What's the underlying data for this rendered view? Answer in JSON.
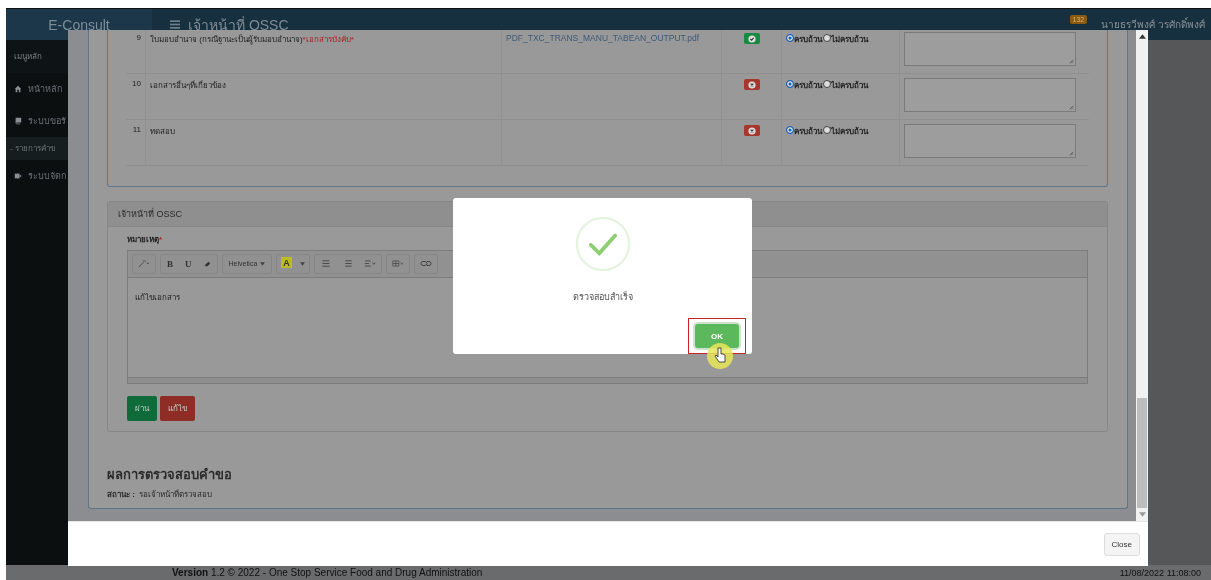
{
  "header": {
    "brand": "E-Consult",
    "title": "เจ้าหน้าที่ OSSC",
    "badge": "132",
    "user": "นายธรวีพงศ์ วรศักดิ์พงศ์"
  },
  "sidebar": {
    "heading": "เมนูหลัก",
    "items": [
      {
        "label": "หน้าหลัก",
        "kind": "home",
        "selected": false
      },
      {
        "label": "ระบบขอรั",
        "kind": "book",
        "selected": false
      },
      {
        "label": "- รายการคำข",
        "kind": "sub",
        "selected": true
      },
      {
        "label": "ระบบจัดก",
        "kind": "video",
        "selected": false
      }
    ]
  },
  "modal": {
    "documents": [
      {
        "no": "9",
        "name": "ใบมอบอำนาจ (กรณีฐานะเป็นผู้รับมอบอำนาจ)",
        "required_note": "*เอกสารบังคับ*",
        "file": "PDF_TXC_TRANS_MANU_TABEAN_OUTPUT.pdf",
        "uploaded": true,
        "options": [
          {
            "label": "ครบถ้วน",
            "selected": true
          },
          {
            "label": "ไม่ครบถ้วน",
            "selected": false
          }
        ]
      },
      {
        "no": "10",
        "name": "เอกสารอื่นๆที่เกี่ยวข้อง",
        "uploaded": false,
        "options": [
          {
            "label": "ครบถ้วน",
            "selected": true
          },
          {
            "label": "ไม่ครบถ้วน",
            "selected": false
          }
        ]
      },
      {
        "no": "11",
        "name": "ทดสอบ",
        "uploaded": false,
        "options": [
          {
            "label": "ครบถ้วน",
            "selected": true
          },
          {
            "label": "ไม่ครบถ้วน",
            "selected": false
          }
        ]
      }
    ],
    "officer_panel": {
      "title": "เจ้าหน้าที่ OSSC",
      "remark_label": "หมายเหตุ",
      "required_mark": "*",
      "toolbar": {
        "bold": "B",
        "underline": "U",
        "font": "Helvetica",
        "font_color_button": "A"
      },
      "editor_text": "แก้ไขเอกสาร",
      "buttons": [
        {
          "label": "ผ่าน",
          "kind": "approve"
        },
        {
          "label": "แก้ไข",
          "kind": "reject"
        }
      ]
    },
    "result": {
      "title": "ผลการตรวจสอบคำขอ",
      "status_label": "สถานะ :",
      "status": "รอเจ้าหน้าที่ตรวจสอบ"
    },
    "close_button": "Close"
  },
  "alert": {
    "kind": "success",
    "message": "ตรวจสอบสำเร็จ",
    "button": "OK"
  },
  "footer": {
    "version_label": "Version",
    "version_text": "1.2 © 2022 - One Stop Service Food and Drug Administration",
    "timestamp": "11/08/2022 11:08:00"
  }
}
